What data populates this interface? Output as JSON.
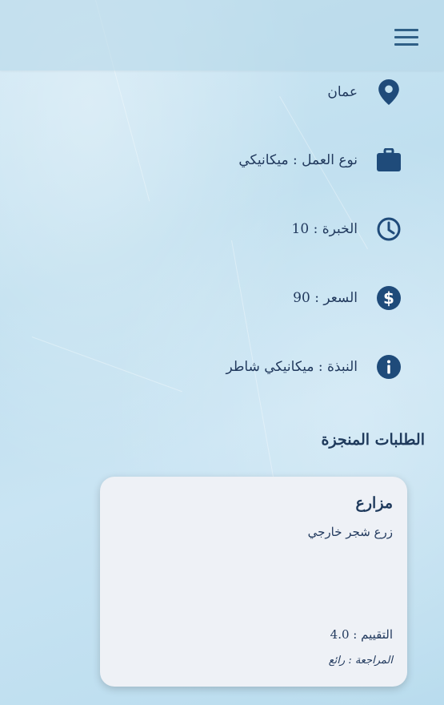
{
  "header": {
    "menu_icon": "hamburger-menu-icon"
  },
  "profile": {
    "location": {
      "icon": "location-pin-icon",
      "text": "عمان"
    },
    "job_type": {
      "icon": "briefcase-icon",
      "text": "نوع العمل : ميكانيكي"
    },
    "experience": {
      "icon": "clock-icon",
      "text": "الخبرة : 10"
    },
    "price": {
      "icon": "dollar-icon",
      "text": "السعر : 90"
    },
    "about": {
      "icon": "info-icon",
      "text": "النبذة : ميكانيكي شاطر"
    }
  },
  "completed_orders": {
    "title": "الطلبات المنجزة",
    "items": [
      {
        "name": "مزارع",
        "description": "زرع شجر خارجي",
        "rating": "التقييم : 4.0",
        "review": "المراجعة : رائع"
      }
    ]
  },
  "colors": {
    "icon": "#1f4b7a",
    "text": "#223a5e"
  }
}
